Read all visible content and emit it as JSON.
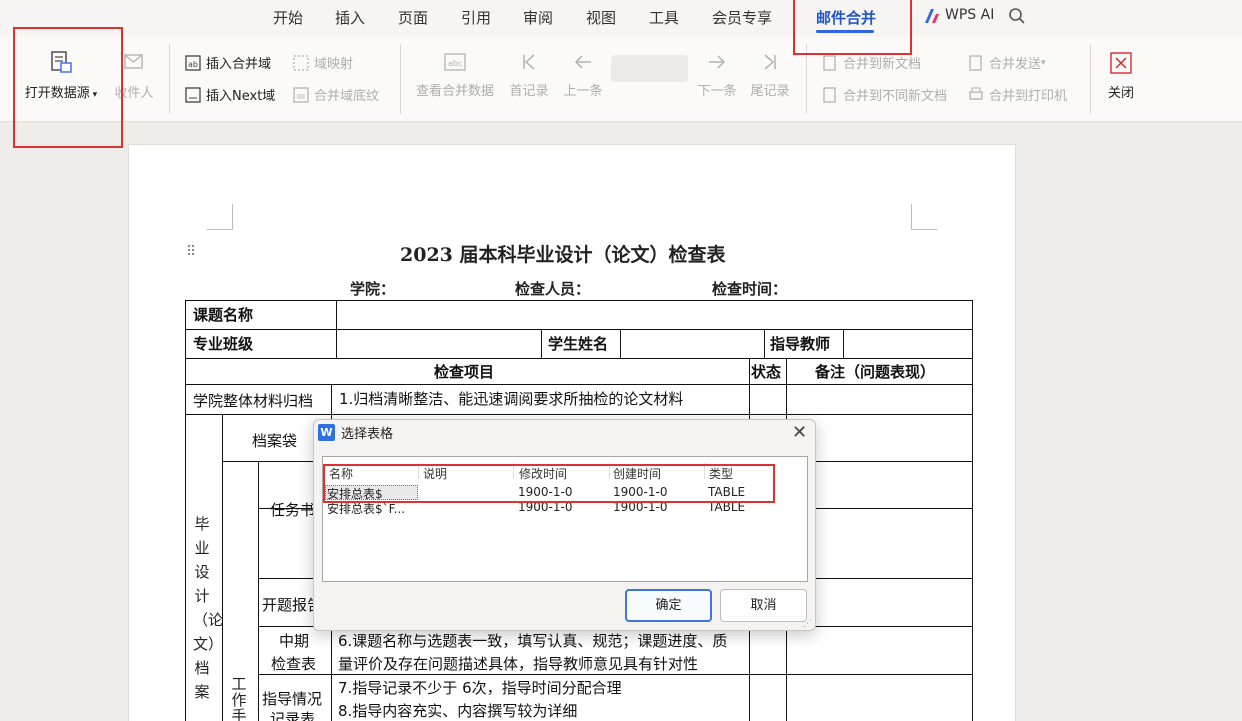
{
  "menu": {
    "tabs": [
      "开始",
      "插入",
      "页面",
      "引用",
      "审阅",
      "视图",
      "工具",
      "会员专享",
      "邮件合并",
      "WPS AI"
    ],
    "active_tab": "邮件合并",
    "accent_color": "#2f65e0"
  },
  "ribbon": {
    "open_datasource": "打开数据源",
    "recipients": "收件人",
    "insert_merge_field": "插入合并域",
    "field_mapping": "域映射",
    "insert_next": "插入Next域",
    "merge_field_shading": "合并域底纹",
    "view_merge_data": "查看合并数据",
    "first_record": "首记录",
    "prev_record": "上一条",
    "next_record": "下一条",
    "last_record": "尾记录",
    "merge_to_new_doc": "合并到新文档",
    "merge_send": "合并发送",
    "merge_to_diff_docs": "合并到不同新文档",
    "merge_to_printer": "合并到打印机",
    "close": "关闭"
  },
  "document": {
    "title": "2023 届本科毕业设计（论文）检查表",
    "college_label": "学院：",
    "inspector_label": "检查人员：",
    "check_time_label": "检查时间：",
    "topic_label": "课题名称",
    "major_class_label": "专业班级",
    "student_name_label": "学生姓名",
    "advisor_label": "指导教师",
    "check_items_header": "检查项目",
    "status_header": "状态",
    "remarks_header": "备注（问题表现）",
    "college_archive_label": "学院整体材料归档",
    "college_archive_item": "1.归档清晰整洁、能迅速调阅要求所抽检的论文材料",
    "archive_bag_label": "档案袋",
    "task_book_label": "任务书",
    "proposal_label": "开题报告",
    "midterm_label_1": "中期",
    "midterm_label_2": "检查表",
    "midterm_item_line1": "6.课题名称与选题表一致，填写认真、规范；课题进度、质",
    "midterm_item_line2": "量评价及存在问题描述具体，指导教师意见具有针对性",
    "guidance_label_1": "指导情况",
    "guidance_label_2": "记录表",
    "guidance_item_7": "7.指导记录不少于 6次，指导时间分配合理",
    "guidance_item_8": "8.指导内容充实、内容撰写较为详细",
    "vertical_main": "毕业设计（论文）档案",
    "vertical_sub": "工作手"
  },
  "dialog": {
    "title": "选择表格",
    "columns": [
      "名称",
      "说明",
      "修改时间",
      "创建时间",
      "类型"
    ],
    "rows": [
      {
        "name": "安排总表$",
        "desc": "",
        "modified": "1900-1-0",
        "created": "1900-1-0",
        "type": "TABLE"
      },
      {
        "name": "安排总表$`F...",
        "desc": "",
        "modified": "1900-1-0",
        "created": "1900-1-0",
        "type": "TABLE"
      }
    ],
    "ok": "确定",
    "cancel": "取消"
  },
  "annotation_color": "#e03131"
}
